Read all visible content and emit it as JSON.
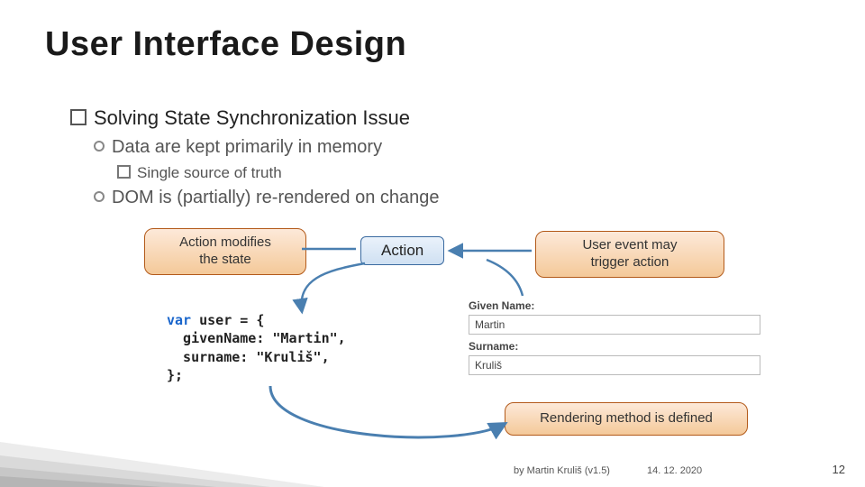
{
  "title": "User Interface Design",
  "bullets": {
    "l1": "Solving State Synchronization Issue",
    "l2a": "Data are kept primarily in memory",
    "l3a": "Single source of truth",
    "l2b": "DOM is (partially) re-rendered on change"
  },
  "callout_left": "Action modifies\nthe state",
  "callout_right": "User event may\ntrigger action",
  "callout_bottom": "Rendering method is defined",
  "action_label": "Action",
  "code": {
    "kw": "var",
    "line1_rest": " user = {",
    "line2": "  givenName: \"Martin\",",
    "line3": "  surname: \"Kruliš\",",
    "line4": "};"
  },
  "form": {
    "label1": "Given Name:",
    "value1": "Martin",
    "label2": "Surname:",
    "value2": "Kruliš"
  },
  "footer": {
    "author": "by Martin Kruliš (v1.5)",
    "date": "14. 12. 2020",
    "page": "12"
  }
}
